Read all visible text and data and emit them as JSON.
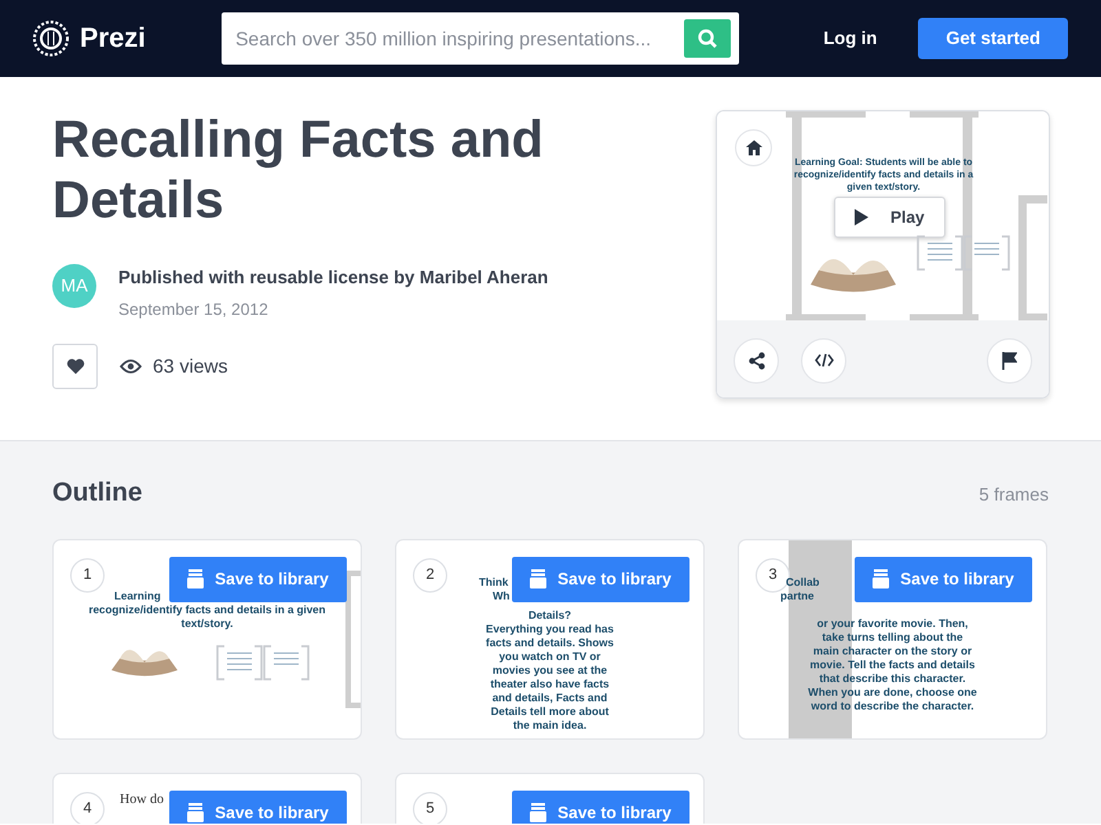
{
  "header": {
    "logo": "Prezi",
    "search": {
      "placeholder": "Search over 350 million inspiring presentations..."
    },
    "login": "Log in",
    "get_started": "Get started"
  },
  "title": "Recalling Facts and Details",
  "author": {
    "avatar": "MA",
    "published": "Published with reusable license by Maribel Aheran",
    "date": "September 15, 2012",
    "views": "63 views"
  },
  "preview": {
    "slide_text": "Learning Goal: Students will be able to recognize/identify facts and details in a given text/story.",
    "play": "Play"
  },
  "outline": {
    "heading": "Outline",
    "count": "5 frames",
    "frames": [
      {
        "number": "1",
        "button": "Save to library",
        "kind": "book",
        "lines": [
          {
            "text": "Learning",
            "kind": "cut"
          },
          {
            "text": "recognize/identify facts and details in a given",
            "kind": "full"
          },
          {
            "text": "text/story.",
            "kind": "full"
          }
        ]
      },
      {
        "number": "2",
        "button": "Save to library",
        "kind": "text",
        "lines": [
          {
            "text": "Think",
            "kind": "cut"
          },
          {
            "text": "Wh",
            "kind": "cut"
          },
          {
            "text": "Details?",
            "kind": "full"
          },
          {
            "text": "Everything you read has",
            "kind": "full"
          },
          {
            "text": "facts and details. Shows",
            "kind": "full"
          },
          {
            "text": "you watch on TV or",
            "kind": "full"
          },
          {
            "text": "movies you see at the",
            "kind": "full"
          },
          {
            "text": "theater also have facts",
            "kind": "full"
          },
          {
            "text": "and details, Facts and",
            "kind": "full"
          },
          {
            "text": "Details tell more about",
            "kind": "full"
          },
          {
            "text": "the main idea.",
            "kind": "full"
          }
        ]
      },
      {
        "number": "3",
        "button": "Save to library",
        "kind": "banded",
        "lines": [
          {
            "text": "Collab",
            "kind": "cut"
          },
          {
            "text": "partne",
            "kind": "cut"
          },
          {
            "text": "or your favorite movie. Then,",
            "kind": "full"
          },
          {
            "text": "take turns telling about the",
            "kind": "full"
          },
          {
            "text": "main character on the story or",
            "kind": "full"
          },
          {
            "text": "movie. Tell the facts and details",
            "kind": "full"
          },
          {
            "text": "that describe this character.",
            "kind": "full"
          },
          {
            "text": "When you are done, choose one",
            "kind": "full"
          },
          {
            "text": "word to describe the character.",
            "kind": "full"
          }
        ]
      },
      {
        "number": "4",
        "button": "Save to library",
        "kind": "serif",
        "lines": [
          {
            "text": "How do",
            "kind": "cut"
          }
        ]
      },
      {
        "number": "5",
        "button": "Save to library",
        "kind": "text"
      }
    ]
  }
}
